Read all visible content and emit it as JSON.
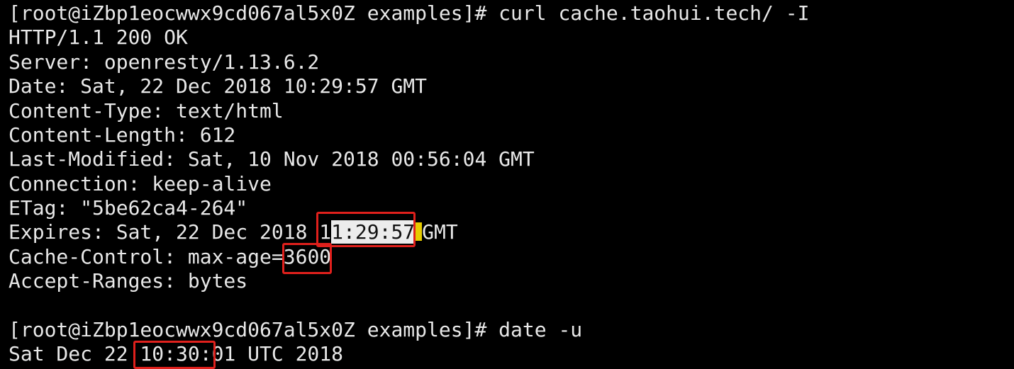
{
  "terminal": {
    "prompt1": "[root@iZbp1eocwwx9cd067al5x0Z examples]# curl cache.taohui.tech/ -I",
    "status_line": "HTTP/1.1 200 OK",
    "server": "Server: openresty/1.13.6.2",
    "date": "Date: Sat, 22 Dec 2018 10:29:57 GMT",
    "content_type": "Content-Type: text/html",
    "content_length": "Content-Length: 612",
    "last_modified": "Last-Modified: Sat, 10 Nov 2018 00:56:04 GMT",
    "connection": "Connection: keep-alive",
    "etag": "ETag: \"5be62ca4-264\"",
    "expires_prefix": "Expires: Sat, 22 Dec 2018 1",
    "expires_selected": "1:29:57",
    "expires_suffix": "GMT",
    "cache_control_prefix": "Cache-Control: max-age=",
    "cache_control_value": "3600",
    "accept_ranges": "Accept-Ranges: bytes",
    "prompt2": "[root@iZbp1eocwwx9cd067al5x0Z examples]# date -u",
    "date_output": "Sat Dec 22 10:30:01 UTC 2018"
  },
  "colors": {
    "background": "#000000",
    "text": "#e8e8e8",
    "highlight_box": "#e0201c",
    "selection": "#ececec",
    "cursor": "#e6cc00"
  }
}
